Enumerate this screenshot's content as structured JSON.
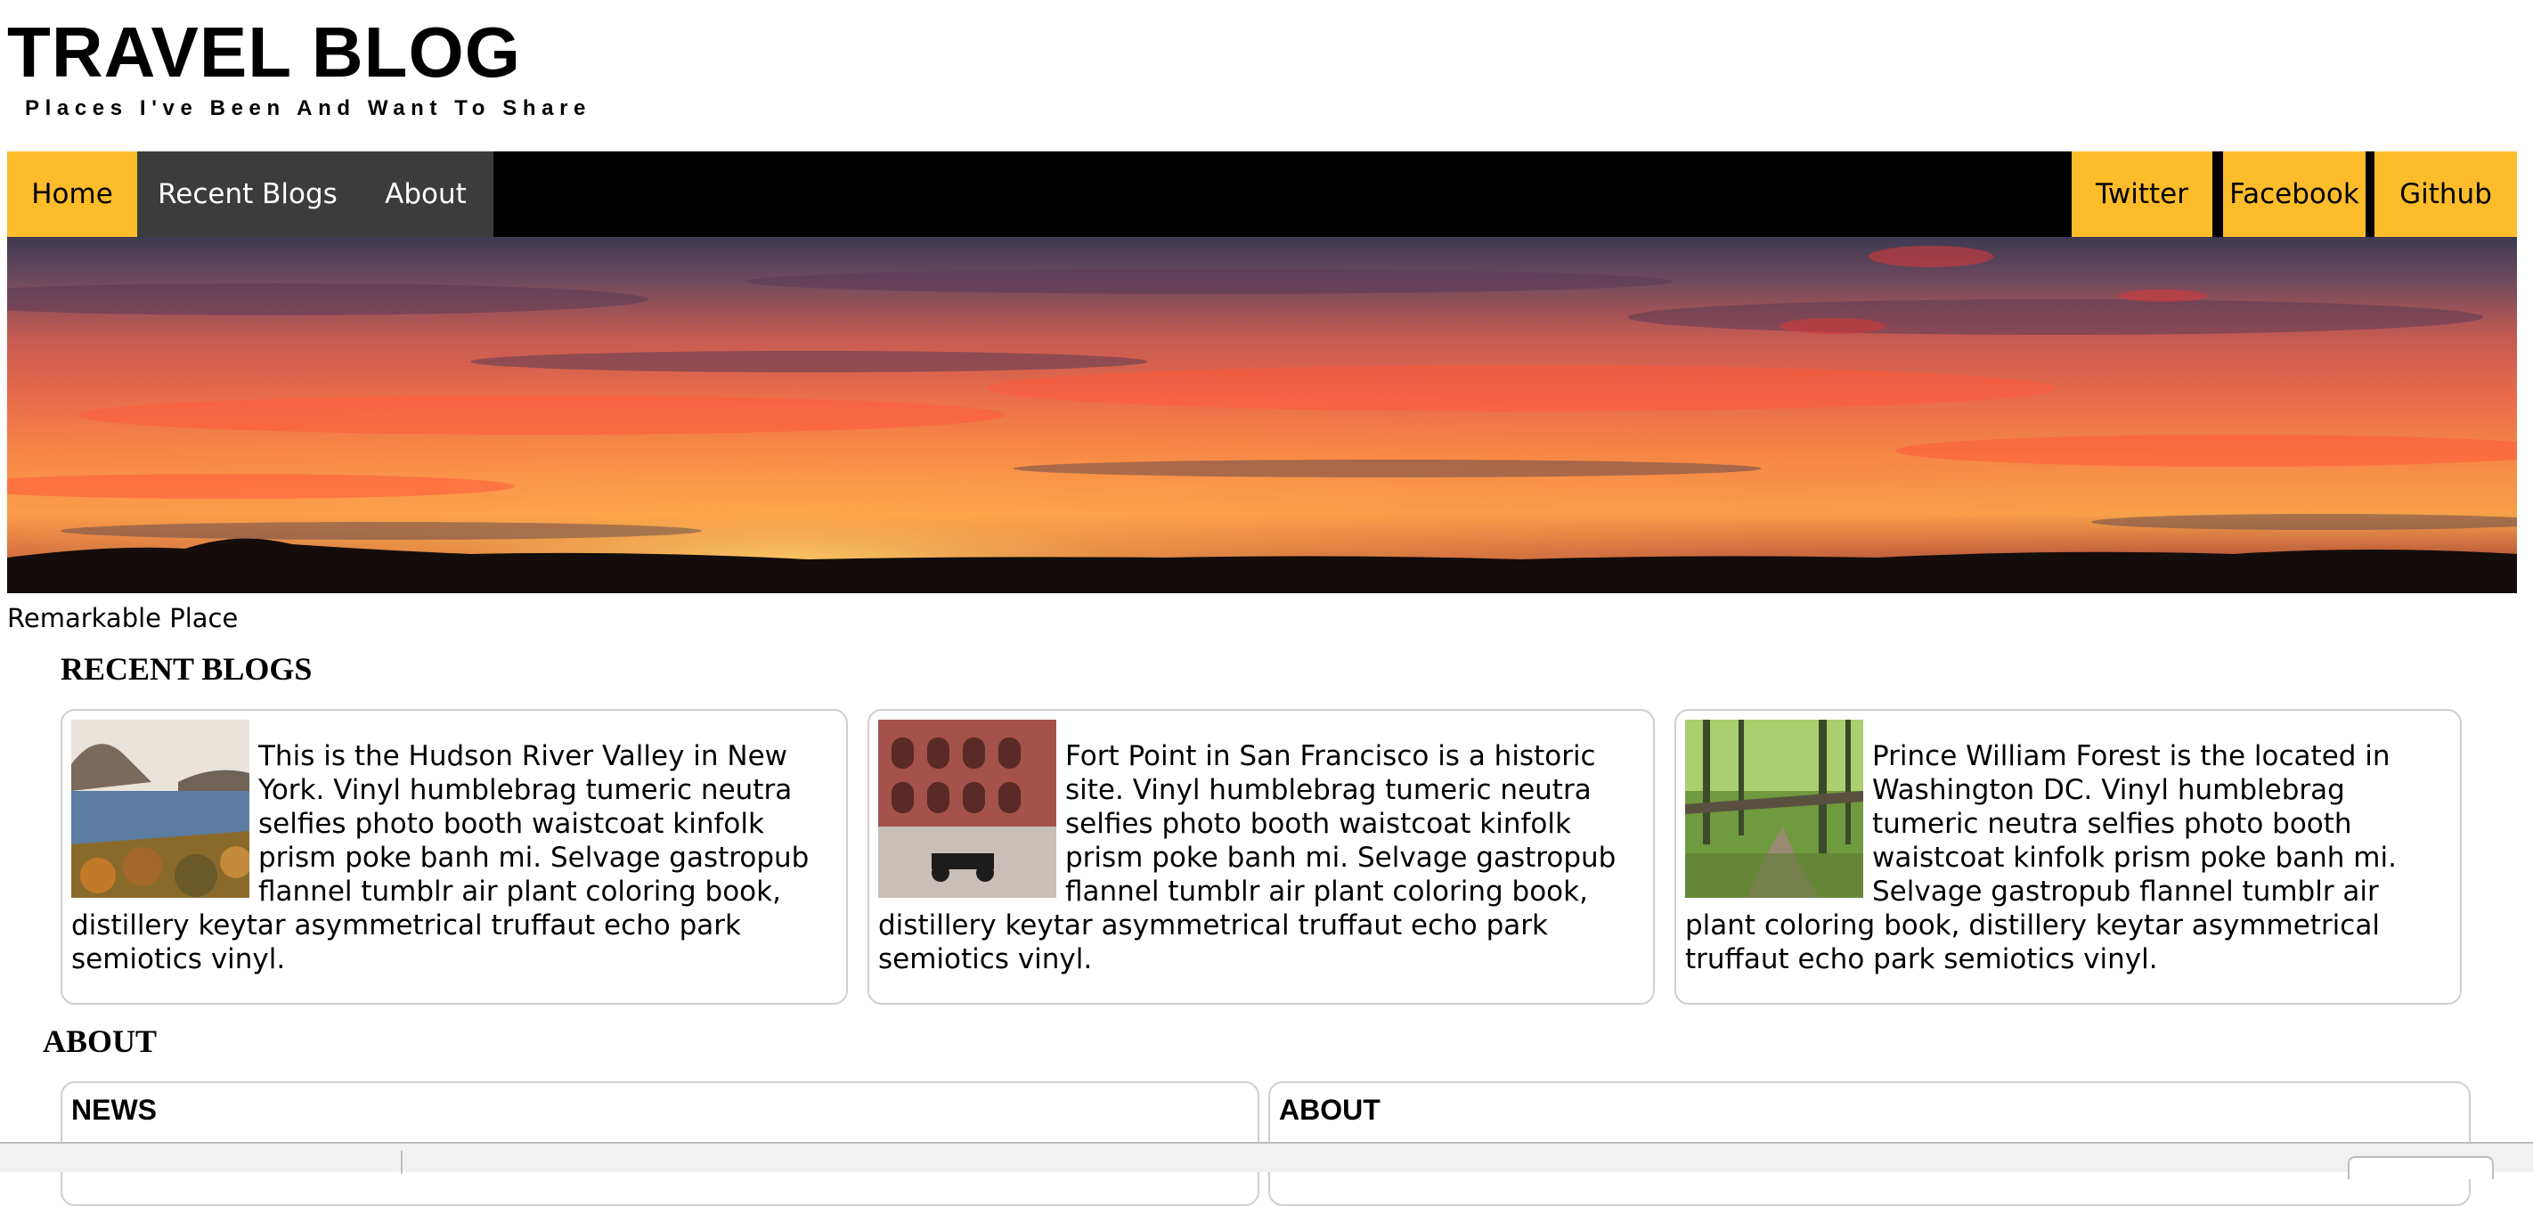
{
  "header": {
    "title": "TRAVEL BLOG",
    "tagline": "Places I've Been And Want To Share"
  },
  "nav": {
    "left": [
      "Home",
      "Recent Blogs",
      "About"
    ],
    "right": [
      "Twitter",
      "Facebook",
      "Github"
    ]
  },
  "hero": {
    "caption": "Remarkable Place"
  },
  "recent": {
    "heading": "RECENT BLOGS",
    "cards": [
      {
        "thumb_icon": "hudson-river-valley-photo",
        "text": "This is the Hudson River Valley in New York. Vinyl humblebrag tumeric neutra selfies photo booth waistcoat kinfolk prism poke banh mi. Selvage gastropub flannel tumblr air plant coloring book, distillery keytar asymmetrical truffaut echo park semiotics vinyl."
      },
      {
        "thumb_icon": "fort-point-photo",
        "text": "Fort Point in San Francisco is a historic site. Vinyl humblebrag tumeric neutra selfies photo booth waistcoat kinfolk prism poke banh mi. Selvage gastropub flannel tumblr air plant coloring book, distillery keytar asymmetrical truffaut echo park semiotics vinyl."
      },
      {
        "thumb_icon": "forest-trail-photo",
        "text": "Prince William Forest is the located in Washington DC. Vinyl humblebrag tumeric neutra selfies photo booth waistcoat kinfolk prism poke banh mi. Selvage gastropub flannel tumblr air plant coloring book, distillery keytar asymmetrical truffaut echo park semiotics vinyl."
      }
    ]
  },
  "about": {
    "heading": "ABOUT",
    "boxes": [
      "NEWS",
      "ABOUT"
    ]
  },
  "colors": {
    "accent": "#fdbd2b",
    "nav_background": "#000000",
    "nav_inactive": "#3c3c3c",
    "border": "#cfcfcf"
  }
}
